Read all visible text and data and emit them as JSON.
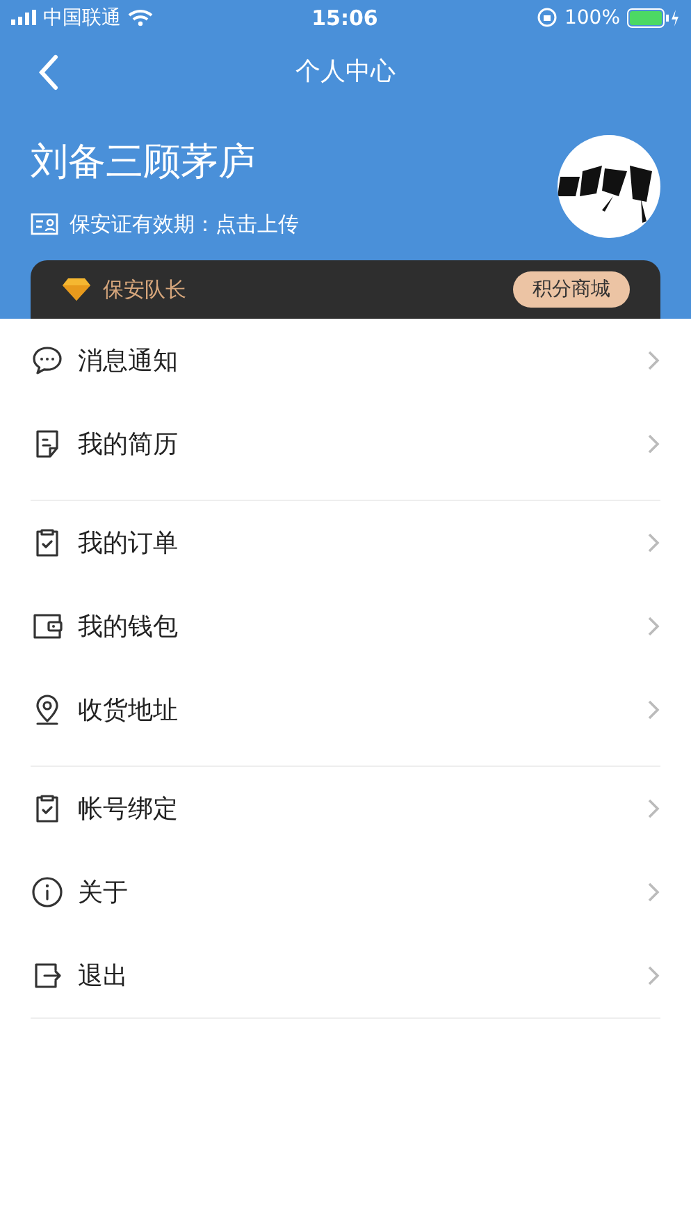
{
  "status_bar": {
    "carrier": "中国联通",
    "time": "15:06",
    "battery": "100%"
  },
  "nav": {
    "title": "个人中心"
  },
  "profile": {
    "name": "刘备三顾茅庐",
    "certificate": "保安证有效期：点击上传"
  },
  "level_card": {
    "rank": "保安队长",
    "button": "积分商城"
  },
  "menu_groups": [
    {
      "items": [
        {
          "kind": "chat",
          "label": "消息通知"
        },
        {
          "kind": "resume",
          "label": "我的简历"
        }
      ]
    },
    {
      "items": [
        {
          "kind": "clipboard",
          "label": "我的订单"
        },
        {
          "kind": "wallet",
          "label": "我的钱包"
        },
        {
          "kind": "location",
          "label": "收货地址"
        }
      ]
    },
    {
      "items": [
        {
          "kind": "clipboard",
          "label": "帐号绑定"
        },
        {
          "kind": "info",
          "label": "关于"
        },
        {
          "kind": "logout",
          "label": "退出"
        }
      ]
    }
  ]
}
